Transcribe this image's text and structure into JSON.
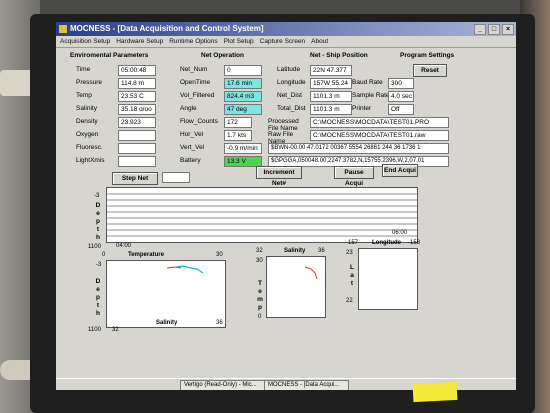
{
  "window": {
    "title": "MOCNESS - [Data Acquisition and Control System]",
    "controls": [
      "_",
      "□",
      "×"
    ]
  },
  "menu": [
    "Acquisition Setup",
    "Hardware Setup",
    "Runtime Options",
    "Plot Setup",
    "Capture Screen",
    "About"
  ],
  "env": {
    "header": "Enviromental Parameters",
    "rows": [
      {
        "label": "Time",
        "value": "05:00:48"
      },
      {
        "label": "Pressure",
        "value": "114.8 m"
      },
      {
        "label": "Temp",
        "value": "23.53 C"
      },
      {
        "label": "Salinity",
        "value": "35.18 o/oo"
      },
      {
        "label": "Density",
        "value": "23.923"
      },
      {
        "label": "Oxygen",
        "value": ""
      },
      {
        "label": "Fluoresc.",
        "value": ""
      },
      {
        "label": "LightXmis",
        "value": ""
      }
    ]
  },
  "net": {
    "header": "Net Operation",
    "rows": [
      {
        "label": "Net_Num",
        "value": "0",
        "style": ""
      },
      {
        "label": "OpenTime",
        "value": "17.6 min",
        "style": "cyan"
      },
      {
        "label": "Vol_Filtered",
        "value": "824.4 m3",
        "style": "cyan"
      },
      {
        "label": "Angle",
        "value": "47 deg",
        "style": "cyan"
      },
      {
        "label": "Flow_Counts",
        "value": "172",
        "style": ""
      },
      {
        "label": "Hor_Vel",
        "value": "1.7 kts",
        "style": ""
      },
      {
        "label": "Vert_Vel",
        "value": "-0.9 m/min",
        "style": ""
      },
      {
        "label": "Battery",
        "value": "13.3 V",
        "style": "green"
      }
    ]
  },
  "ship": {
    "header": "Net - Ship Position",
    "rows": [
      {
        "label": "Latitude",
        "value": "22N 47.377"
      },
      {
        "label": "Longitude",
        "value": "157W 55.24"
      },
      {
        "label": "Net_Dist",
        "value": "1101.3 m"
      },
      {
        "label": "Total_Dist",
        "value": "1101.3 m"
      }
    ]
  },
  "program": {
    "header": "Program Settings",
    "reset": "Reset",
    "rows": [
      {
        "label": "Baud Rate",
        "value": "300"
      },
      {
        "label": "Sample Rate",
        "value": "4.0 sec"
      },
      {
        "label": "Printer",
        "value": "Off"
      }
    ]
  },
  "files": {
    "processed_label": "Processed File Name",
    "processed": "C:\\MOCNESS\\MOCDATA\\TEST01.PRO",
    "raw_label": "Raw File Name",
    "raw": "C:\\MOCNESS\\MOCDATA\\TEST01.raw",
    "line1": "$BWN-00.00 47.0172 00367 5554 26861 244 36 1736 1",
    "line2": "$GPGGA,050048.00,2247.3782,N,15755.2396,W,2,07,01"
  },
  "buttons": {
    "step": "Step Net",
    "increment": "Increment Net#",
    "pause": "Pause Acqui",
    "end": "End Acqui"
  },
  "depth_plot": {
    "ymin": "-3",
    "ymax": "1100",
    "xstart": "04:00",
    "xend": "06:00",
    "ylabel": "Depth"
  },
  "ts_plot": {
    "top_title": "Temperature",
    "top_left": "0",
    "top_right": "30",
    "ymin": "-3",
    "ymax": "1100",
    "bottom_left": "32",
    "bottom_right": "36",
    "bottom_title": "Salinity",
    "ylabel": "Depth"
  },
  "tsal_plot": {
    "title": "Salinity",
    "xleft": "32",
    "xright": "36",
    "ytop": "30",
    "ybottom": "0",
    "ylabel": "Temp"
  },
  "lon_plot": {
    "title": "Longitude",
    "xleft": "-157",
    "xright": "-158",
    "ytop": "23",
    "ybottom": "22",
    "ylabel": "Lat"
  },
  "taskbar": {
    "task1": "Vertigo (Read-Only) - Mic...",
    "task2": "MOCNESS - [Data Acqui..."
  }
}
